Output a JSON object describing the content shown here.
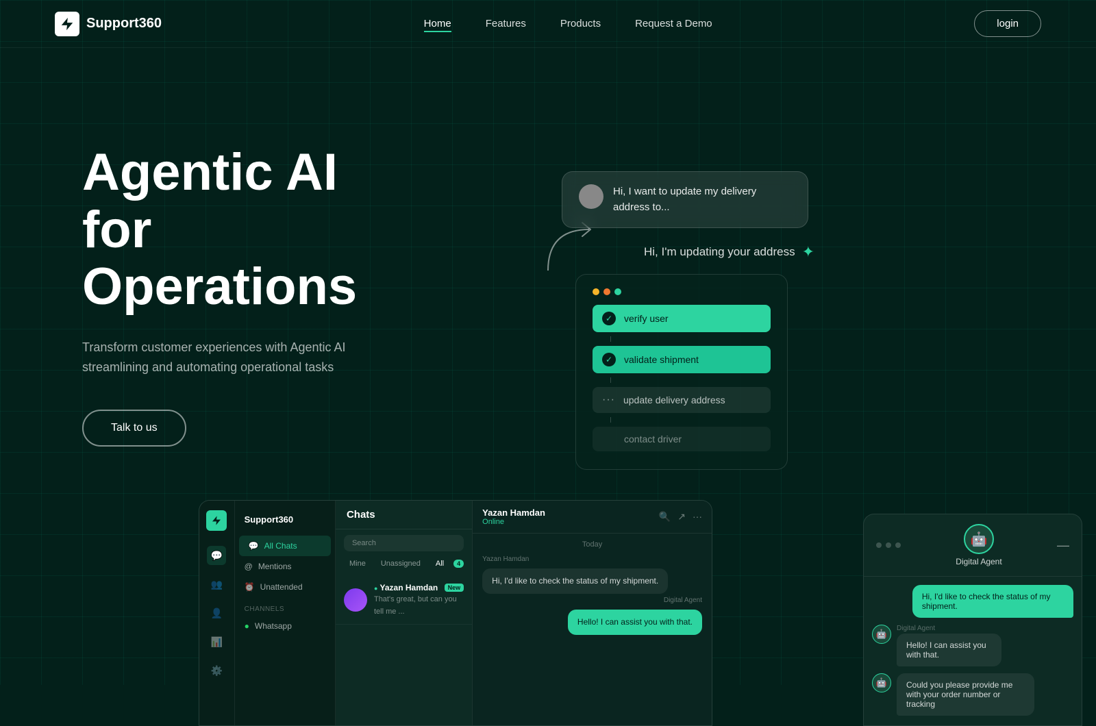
{
  "brand": {
    "name": "Support360",
    "icon": "⚡"
  },
  "nav": {
    "links": [
      {
        "label": "Home",
        "active": true
      },
      {
        "label": "Features",
        "active": false
      },
      {
        "label": "Products",
        "active": false
      },
      {
        "label": "Request a Demo",
        "active": false
      }
    ],
    "login_label": "login"
  },
  "hero": {
    "title_line1": "Agentic AI",
    "title_line2": "for Operations",
    "subtitle": "Transform customer experiences with Agentic AI streamlining and automating operational tasks",
    "cta_label": "Talk to us"
  },
  "chat_widget": {
    "user_message": "Hi, I want to update my delivery address to...",
    "ai_message": "Hi, I'm updating your address",
    "steps": [
      {
        "label": "verify user",
        "status": "done"
      },
      {
        "label": "validate shipment",
        "status": "done"
      },
      {
        "label": "update delivery address",
        "status": "pending"
      },
      {
        "label": "contact driver",
        "status": "inactive"
      }
    ]
  },
  "chat_app": {
    "brand": "Support360",
    "section": "Chats",
    "nav_items": [
      {
        "label": "All Chats",
        "active": true
      },
      {
        "label": "Mentions",
        "active": false
      },
      {
        "label": "Unattended",
        "active": false
      }
    ],
    "channels_label": "Channels",
    "whatsapp_label": "Whatsapp",
    "search_placeholder": "Search",
    "tabs": [
      {
        "label": "Mine",
        "active": false
      },
      {
        "label": "Unassigned",
        "active": false
      },
      {
        "label": "All",
        "active": true,
        "badge": "4"
      }
    ],
    "contacts": [
      {
        "name": "Yazan Hamdan",
        "online": true,
        "preview": "That's great, but can you tell me ...",
        "badge": "New"
      }
    ]
  },
  "conversation": {
    "user_name": "Yazan Hamdan",
    "status": "Online",
    "date_label": "Today",
    "sender_label": "Yazan Hamdan",
    "user_message": "Hi, I'd like to check the status of my shipment.",
    "agent_label": "Digital Agent",
    "agent_message": "Hello! I can assist you with that."
  },
  "digital_agent": {
    "title": "Digital Agent",
    "user_message": "Hi, I'd like to check the status of my shipment.",
    "agent_message_1": "Hello! I can assist you with that.",
    "agent_message_2": "Could you please provide me with your order number or tracking"
  }
}
